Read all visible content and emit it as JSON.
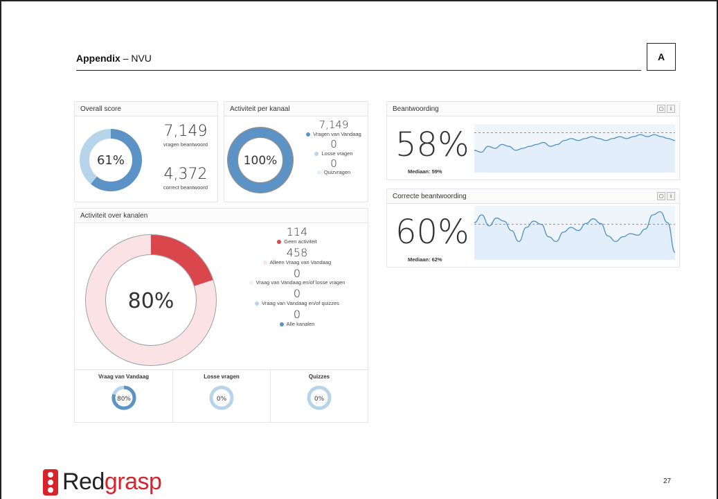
{
  "header": {
    "title_bold": "Appendix",
    "title_rest": " – NVU",
    "badge": "A"
  },
  "overall_score": {
    "title": "Overall score",
    "percent_label": "61%",
    "percent": 0.61,
    "answered_value": "7,149",
    "answered_label": "vragen beantwoord",
    "correct_value": "4,372",
    "correct_label": "correct beantwoord",
    "color_main": "#5b93c7",
    "color_rest": "#b7d5ea"
  },
  "activity_per_channel": {
    "title": "Activiteit per kanaal",
    "percent_label": "100%",
    "percent": 1.0,
    "items": [
      {
        "value": "7,149",
        "label": "Vragen van Vandaag",
        "color": "#5b93c7"
      },
      {
        "value": "0",
        "label": "Losse vragen",
        "color": "#b7d5ea"
      },
      {
        "value": "0",
        "label": "Quizvragen",
        "color": "#e3eef7"
      }
    ]
  },
  "activity_over_channels": {
    "title": "Activiteit over kanalen",
    "percent_label": "80%",
    "percent_red": 0.2,
    "color_red": "#d9474c",
    "color_pink": "#fbe3e5",
    "items": [
      {
        "value": "114",
        "label": "Geen activiteit",
        "color": "#d9474c"
      },
      {
        "value": "458",
        "label": "Alleen Vraag van Vandaag",
        "color": "#fbe3e5"
      },
      {
        "value": "0",
        "label": "Vraag van Vandaag en/of losse vragen",
        "color": "#f1f1f1"
      },
      {
        "value": "0",
        "label": "Vraag van Vandaag en/of quizzes",
        "color": "#b7d5ea"
      },
      {
        "value": "0",
        "label": "Alle kanalen",
        "color": "#5b93c7"
      }
    ],
    "sub": [
      {
        "label": "Vraag van Vandaag",
        "percent_label": "80%",
        "percent": 0.8
      },
      {
        "label": "Losse vragen",
        "percent_label": "0%",
        "percent": 0.0
      },
      {
        "label": "Quizzes",
        "percent_label": "0%",
        "percent": 0.0
      }
    ]
  },
  "beantwoording": {
    "title": "Beantwoording",
    "percent_label": "58%",
    "median_label": "Mediaan: 59%",
    "tool_calendar": "calendar-icon",
    "tool_info": "i",
    "series": [
      50,
      49,
      52,
      51,
      53,
      52,
      50,
      51,
      52,
      53,
      54,
      52,
      53,
      55,
      56,
      55,
      56,
      57,
      56,
      55,
      56,
      57,
      56,
      57,
      58,
      57,
      58,
      57,
      56,
      55
    ],
    "median": 59
  },
  "correcte_beantwoording": {
    "title": "Correcte beantwoording",
    "percent_label": "60%",
    "median_label": "Mediaan: 62%",
    "tool_calendar": "calendar-icon",
    "tool_info": "i",
    "series": [
      64,
      74,
      60,
      70,
      66,
      54,
      40,
      58,
      66,
      62,
      46,
      40,
      52,
      58,
      54,
      63,
      69,
      63,
      47,
      40,
      46,
      50,
      48,
      56,
      74,
      78,
      64,
      26
    ],
    "median": 62
  },
  "page_number": "27",
  "logo": {
    "part1": "Red",
    "part2": "grasp"
  }
}
